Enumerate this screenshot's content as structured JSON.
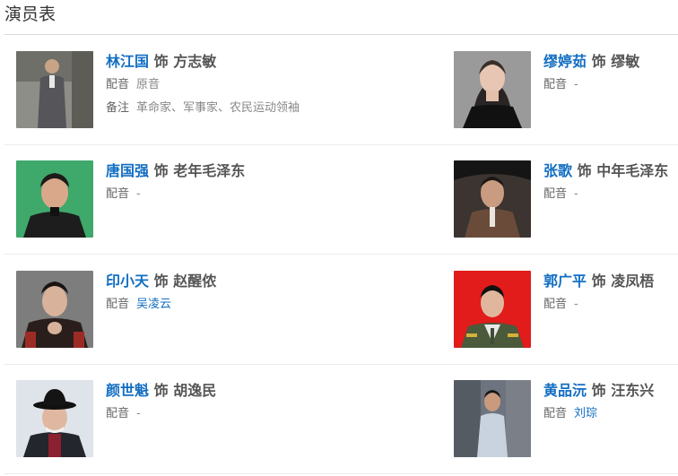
{
  "section": {
    "title": "演员表"
  },
  "cast": [
    {
      "actor": "林江国",
      "sep": "饰",
      "role": "方志敏",
      "dub_label": "配音",
      "dub": "原音",
      "dub_link": false,
      "note_label": "备注",
      "note": "革命家、军事家、农民运动领袖"
    },
    {
      "actor": "缪婷茹",
      "sep": "饰",
      "role": "缪敏",
      "dub_label": "配音",
      "dub": "-",
      "dub_link": false
    },
    {
      "actor": "唐国强",
      "sep": "饰",
      "role": "老年毛泽东",
      "dub_label": "配音",
      "dub": "-",
      "dub_link": false
    },
    {
      "actor": "张歌",
      "sep": "饰",
      "role": "中年毛泽东",
      "dub_label": "配音",
      "dub": "-",
      "dub_link": false
    },
    {
      "actor": "印小天",
      "sep": "饰",
      "role": "赵醒侬",
      "dub_label": "配音",
      "dub": "吴凌云",
      "dub_link": true
    },
    {
      "actor": "郭广平",
      "sep": "饰",
      "role": "凌凤梧",
      "dub_label": "配音",
      "dub": "-",
      "dub_link": false
    },
    {
      "actor": "颜世魁",
      "sep": "饰",
      "role": "胡逸民",
      "dub_label": "配音",
      "dub": "-",
      "dub_link": false
    },
    {
      "actor": "黄品沅",
      "sep": "饰",
      "role": "汪东兴",
      "dub_label": "配音",
      "dub": "刘琮",
      "dub_link": true
    }
  ],
  "colors": {
    "link": "#136ec2",
    "text": "#333333",
    "muted": "#888888",
    "divider": "#d9d9d9"
  }
}
